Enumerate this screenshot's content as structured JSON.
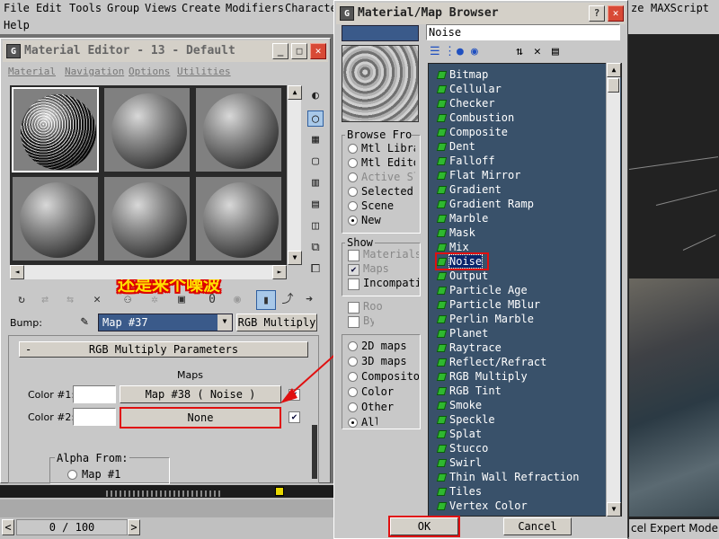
{
  "menubar": {
    "items": [
      "File",
      "Edit",
      "Tools",
      "Group",
      "Views",
      "Create",
      "Modifiers",
      "Character",
      "ze",
      "MAXScript",
      "Help"
    ]
  },
  "material_editor": {
    "title": "Material Editor - 13 - Default",
    "menus": [
      "Material",
      "Navigation",
      "Options",
      "Utilities"
    ],
    "annotation": "还是来个噪波",
    "bump_label": "Bump:",
    "bump_map_value": "Map #37",
    "bump_type": "RGB Multiply",
    "rollout_minus": "-",
    "rollout_title": "RGB Multiply Parameters",
    "maps_header": "Maps",
    "color1_label": "Color #1:",
    "color1_map": "Map #38  ( Noise )",
    "color2_label": "Color #2:",
    "color2_map": "None",
    "alpha_from_label": "Alpha From:",
    "alpha_option1": "Map #1",
    "status_counter": "0 / 100",
    "status_left_arrow": "<",
    "status_right_arrow": ">",
    "material_id_button": "0",
    "icons": [
      "sphere-type-icon",
      "backlight-icon",
      "checker-bg-icon",
      "sample-uv-icon",
      "video-check-icon",
      "make-preview-icon",
      "options-icon",
      "select-by-material-icon",
      "material-map-navigator-icon"
    ]
  },
  "browser": {
    "title": "Material/Map Browser",
    "help_button": "?",
    "search_value": "Noise",
    "browse_from_label": "Browse From:",
    "browse_from_options": [
      "Mtl Library",
      "Mtl Editor",
      "Active Slot",
      "Selected",
      "Scene",
      "New"
    ],
    "browse_from_selected": "New",
    "show_label": "Show",
    "show_options": [
      "Materials",
      "Maps",
      "Incompatible"
    ],
    "show_maps_checked": true,
    "root_options": [
      "Root Only",
      "By Object"
    ],
    "category_options": [
      "2D maps",
      "3D maps",
      "Compositors",
      "Color Mods",
      "Other",
      "All"
    ],
    "category_selected": "All",
    "map_list": [
      "Bitmap",
      "Cellular",
      "Checker",
      "Combustion",
      "Composite",
      "Dent",
      "Falloff",
      "Flat Mirror",
      "Gradient",
      "Gradient Ramp",
      "Marble",
      "Mask",
      "Mix",
      "Noise",
      "Output",
      "Particle Age",
      "Particle MBlur",
      "Perlin Marble",
      "Planet",
      "Raytrace",
      "Reflect/Refract",
      "RGB Multiply",
      "RGB Tint",
      "Smoke",
      "Speckle",
      "Splat",
      "Stucco",
      "Swirl",
      "Thin Wall Refraction",
      "Tiles",
      "Vertex Color"
    ],
    "selected_item": "Noise",
    "ok_label": "OK",
    "cancel_label": "Cancel"
  },
  "right_status": "cel Expert Mode",
  "colors": {
    "accent_red": "#e01010",
    "list_bg": "#39516a",
    "list_icon": "#2fb82f"
  }
}
